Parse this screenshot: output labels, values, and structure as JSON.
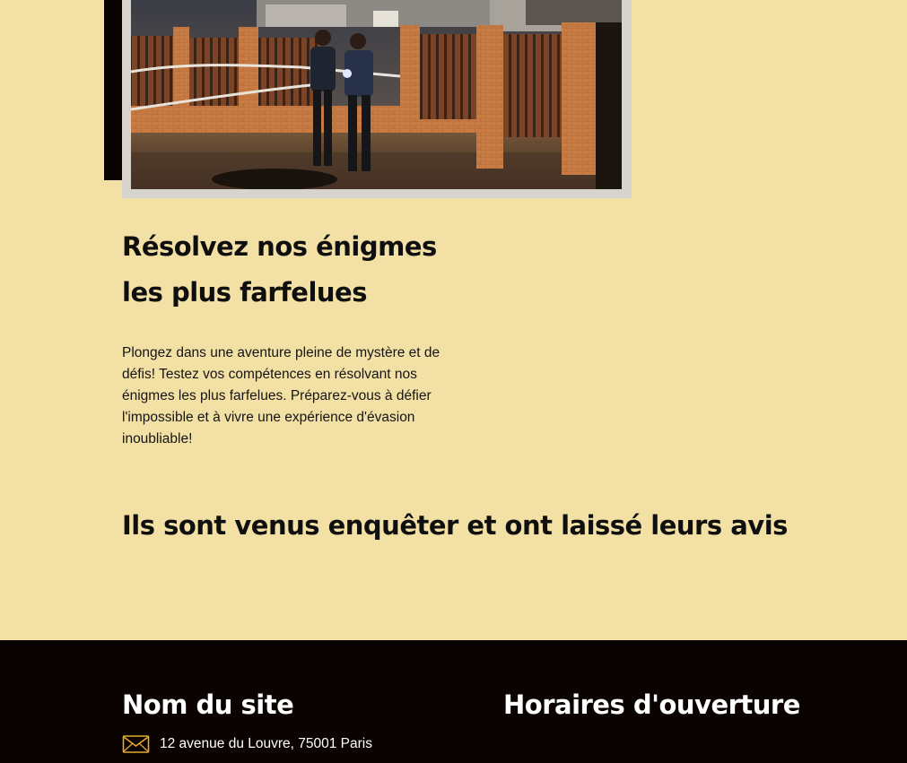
{
  "hero": {
    "image_alt": "Deux enquêteurs examinant une scène de crime de nuit"
  },
  "feature": {
    "title": "Résolvez nos énigmes les plus farfelues",
    "description": "Plongez dans une aventure pleine de mystère et de défis! Testez vos compétences en résolvant nos énigmes les plus farfelues. Préparez-vous à défier l'impossible et à vivre une expérience d'évasion inoubliable!"
  },
  "reviews": {
    "title": "Ils sont venus enquêter et ont laissé leurs avis"
  },
  "footer": {
    "site_name": "Nom du site",
    "address": "12 avenue du Louvre, 75001 Paris",
    "hours_title": "Horaires d'ouverture",
    "address_icon": "mail-icon"
  },
  "colors": {
    "page_background": "#f2e0a5",
    "footer_background": "#0b0202",
    "accent": "#e3a92b",
    "frame": "#d7d4cd"
  }
}
